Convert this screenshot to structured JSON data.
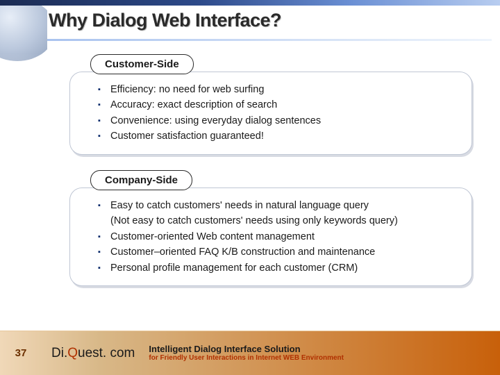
{
  "slide": {
    "number": "37",
    "title": "Why Dialog Web Interface?"
  },
  "sections": {
    "customer": {
      "label": "Customer-Side",
      "items": [
        "Efficiency: no need for web surfing",
        "Accuracy: exact description of search",
        "Convenience: using everyday dialog sentences",
        "Customer satisfaction guaranteed!"
      ]
    },
    "company": {
      "label": "Company-Side",
      "items": [
        "Easy to catch customers' needs in natural language query",
        "(Not easy to catch customers' needs using only keywords query)",
        "Customer-oriented Web content management",
        "Customer–oriented FAQ K/B construction and maintenance",
        "Personal profile management for each customer (CRM)"
      ]
    }
  },
  "footer": {
    "brand_pre": "Di.",
    "brand_q": "Q",
    "brand_post": "uest. com",
    "title": "Intelligent Dialog Interface Solution",
    "subtitle": "for Friendly User Interactions in Internet WEB Environment"
  }
}
